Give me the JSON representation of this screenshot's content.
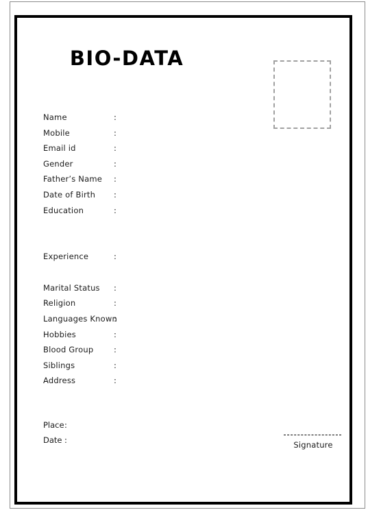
{
  "document": {
    "title": "BIO-DATA",
    "photo_box": {
      "label": "photo-placeholder",
      "border_style": "dashed",
      "border_color": "#a0a0a0"
    },
    "border_color": "#000000",
    "outer_border_color": "#8a8a8a",
    "text_color": "#1a1a1a",
    "colon": ":"
  },
  "fields": {
    "group_personal": [
      {
        "label": "Name",
        "value": ""
      },
      {
        "label": "Mobile",
        "value": ""
      },
      {
        "label": "Email id",
        "value": ""
      },
      {
        "label": "Gender",
        "value": ""
      },
      {
        "label": "Father’s Name",
        "value": ""
      },
      {
        "label": "Date of Birth",
        "value": ""
      },
      {
        "label": "Education",
        "value": ""
      }
    ],
    "group_experience": [
      {
        "label": "Experience",
        "value": ""
      }
    ],
    "group_other": [
      {
        "label": "Marital Status",
        "value": ""
      },
      {
        "label": "Religion",
        "value": ""
      },
      {
        "label": "Languages Known",
        "value": ""
      },
      {
        "label": "Hobbies",
        "value": ""
      },
      {
        "label": "Blood Group",
        "value": ""
      },
      {
        "label": "Siblings",
        "value": ""
      },
      {
        "label": "Address",
        "value": ""
      }
    ]
  },
  "footer": {
    "place": {
      "label": "Place",
      "colon": ":",
      "value": ""
    },
    "date": {
      "label": "Date",
      "colon": ":",
      "value": ""
    },
    "signature_label": "Signature"
  }
}
